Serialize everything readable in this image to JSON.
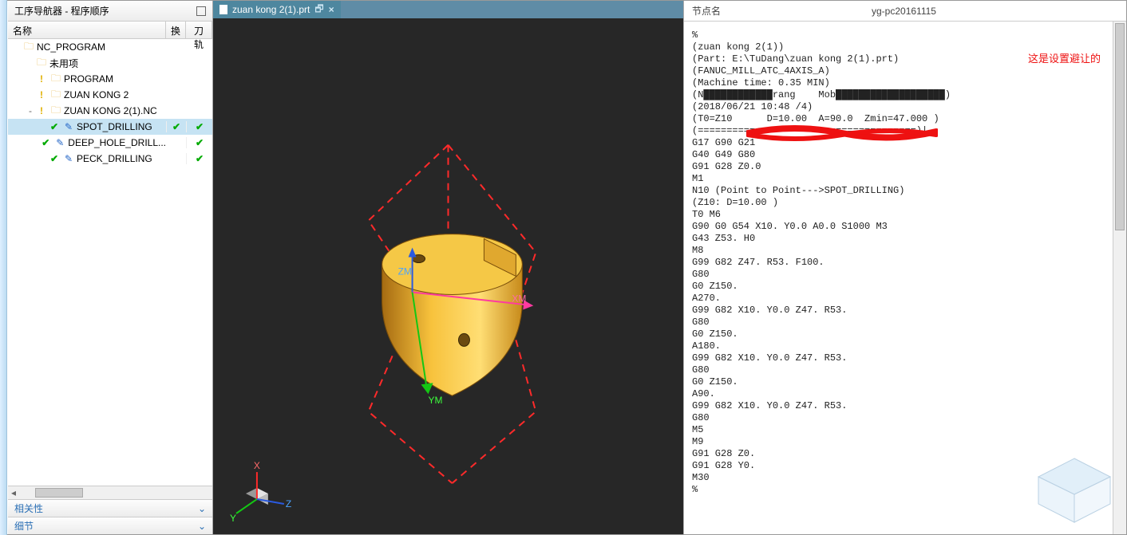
{
  "left_panel": {
    "title": "工序导航器 - 程序顺序",
    "columns": {
      "name": "名称",
      "huan": "换",
      "dao": "刀轨"
    },
    "tree": [
      {
        "level": 0,
        "twist": "",
        "icons": [
          "folder"
        ],
        "label": "NC_PROGRAM",
        "h": "",
        "d": ""
      },
      {
        "level": 1,
        "twist": "",
        "icons": [
          "folder"
        ],
        "label": "未用项",
        "h": "",
        "d": ""
      },
      {
        "level": 1,
        "twist": "",
        "icons": [
          "bang",
          "folder"
        ],
        "label": "PROGRAM",
        "h": "",
        "d": ""
      },
      {
        "level": 1,
        "twist": "",
        "icons": [
          "bang",
          "folder"
        ],
        "label": "ZUAN KONG 2",
        "h": "",
        "d": ""
      },
      {
        "level": 1,
        "twist": "-",
        "icons": [
          "bang",
          "folder"
        ],
        "label": "ZUAN KONG 2(1).NC",
        "h": "",
        "d": ""
      },
      {
        "level": 2,
        "twist": "",
        "icons": [
          "check",
          "opicon"
        ],
        "label": "SPOT_DRILLING",
        "h": "✓",
        "d": "✓",
        "selected": true
      },
      {
        "level": 2,
        "twist": "",
        "icons": [
          "check",
          "opicon"
        ],
        "label": "DEEP_HOLE_DRILL...",
        "h": "",
        "d": "✓"
      },
      {
        "level": 2,
        "twist": "",
        "icons": [
          "check",
          "opicon"
        ],
        "label": "PECK_DRILLING",
        "h": "",
        "d": "✓"
      }
    ],
    "sections": {
      "rel": "相关性",
      "detail": "细节"
    }
  },
  "tab": {
    "label": "zuan kong 2(1).prt"
  },
  "viewport": {
    "axes": {
      "zm": "ZM",
      "xm": "XM",
      "ym": "YM"
    },
    "triad": {
      "x": "X",
      "y": "Y",
      "z": "Z"
    }
  },
  "right_panel": {
    "head_label": "节点名",
    "head_value": "yg-pc20161115",
    "annotation": "这是设置避让的",
    "code_lines": [
      "%",
      "(zuan kong 2(1))",
      "(Part: E:\\TuDang\\zuan kong 2(1).prt)",
      "(FANUC_MILL_ATC_4AXIS_A)",
      "(Machine time: 0.35 MIN)",
      "(N████████████rang    Mob███████████████████)",
      "(2018/06/21 10:48 /4)",
      "(T0=Z10      D=10.00  A=90.0  Zmin=47.000 )",
      "(======================================)|",
      "G17 G90 G21",
      "G40 G49 G80",
      "G91 G28 Z0.0",
      "M1",
      "N10 (Point to Point--->SPOT_DRILLING)",
      "(Z10: D=10.00 )",
      "T0 M6",
      "G90 G0 G54 X10. Y0.0 A0.0 S1000 M3",
      "G43 Z53. H0",
      "M8",
      "G99 G82 Z47. R53. F100.",
      "G80",
      "G0 Z150.",
      "A270.",
      "G99 G82 X10. Y0.0 Z47. R53.",
      "G80",
      "G0 Z150.",
      "A180.",
      "G99 G82 X10. Y0.0 Z47. R53.",
      "G80",
      "G0 Z150.",
      "A90.",
      "G99 G82 X10. Y0.0 Z47. R53.",
      "G80",
      "M5",
      "M9",
      "G91 G28 Z0.",
      "G91 G28 Y0.",
      "M30",
      "%"
    ]
  }
}
